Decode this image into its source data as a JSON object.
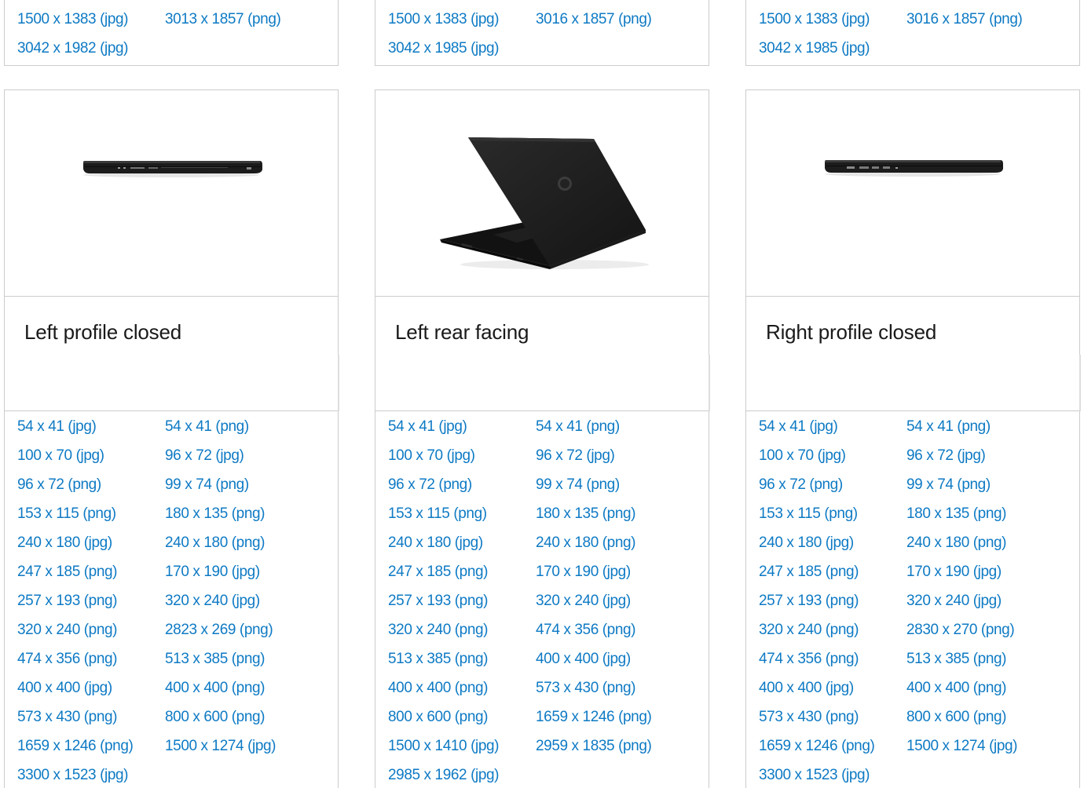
{
  "top_cards": [
    {
      "links": [
        "1500 x 1383 (jpg)",
        "3013 x 1857 (png)",
        "3042 x 1982 (jpg)"
      ]
    },
    {
      "links": [
        "1500 x 1383 (jpg)",
        "3016 x 1857 (png)",
        "3042 x 1985 (jpg)"
      ]
    },
    {
      "links": [
        "1500 x 1383 (jpg)",
        "3016 x 1857 (png)",
        "3042 x 1985 (jpg)"
      ]
    }
  ],
  "cards": [
    {
      "title": "Left profile closed",
      "image_icon": "laptop-left-profile-closed",
      "links": [
        "54 x 41 (jpg)",
        "54 x 41 (png)",
        "100 x 70 (jpg)",
        "96 x 72 (jpg)",
        "96 x 72 (png)",
        "99 x 74 (png)",
        "153 x 115 (png)",
        "180 x 135 (png)",
        "240 x 180 (jpg)",
        "240 x 180 (png)",
        "247 x 185 (png)",
        "170 x 190 (jpg)",
        "257 x 193 (png)",
        "320 x 240 (jpg)",
        "320 x 240 (png)",
        "2823 x 269 (png)",
        "474 x 356 (png)",
        "513 x 385 (png)",
        "400 x 400 (jpg)",
        "400 x 400 (png)",
        "573 x 430 (png)",
        "800 x 600 (png)",
        "1659 x 1246 (png)",
        "1500 x 1274 (jpg)",
        "3300 x 1523 (jpg)"
      ]
    },
    {
      "title": "Left rear facing",
      "image_icon": "laptop-left-rear-facing",
      "links": [
        "54 x 41 (jpg)",
        "54 x 41 (png)",
        "100 x 70 (jpg)",
        "96 x 72 (jpg)",
        "96 x 72 (png)",
        "99 x 74 (png)",
        "153 x 115 (png)",
        "180 x 135 (png)",
        "240 x 180 (jpg)",
        "240 x 180 (png)",
        "247 x 185 (png)",
        "170 x 190 (jpg)",
        "257 x 193 (png)",
        "320 x 240 (jpg)",
        "320 x 240 (png)",
        "474 x 356 (png)",
        "513 x 385 (png)",
        "400 x 400 (jpg)",
        "400 x 400 (png)",
        "573 x 430 (png)",
        "800 x 600 (png)",
        "1659 x 1246 (png)",
        "1500 x 1410 (jpg)",
        "2959 x 1835 (png)",
        "2985 x 1962 (jpg)"
      ]
    },
    {
      "title": "Right profile closed",
      "image_icon": "laptop-right-profile-closed",
      "links": [
        "54 x 41 (jpg)",
        "54 x 41 (png)",
        "100 x 70 (jpg)",
        "96 x 72 (jpg)",
        "96 x 72 (png)",
        "99 x 74 (png)",
        "153 x 115 (png)",
        "180 x 135 (png)",
        "240 x 180 (jpg)",
        "240 x 180 (png)",
        "247 x 185 (png)",
        "170 x 190 (jpg)",
        "257 x 193 (png)",
        "320 x 240 (jpg)",
        "320 x 240 (png)",
        "2830 x 270 (png)",
        "474 x 356 (png)",
        "513 x 385 (png)",
        "400 x 400 (jpg)",
        "400 x 400 (png)",
        "573 x 430 (png)",
        "800 x 600 (png)",
        "1659 x 1246 (png)",
        "1500 x 1274 (jpg)",
        "3300 x 1523 (jpg)"
      ]
    }
  ],
  "colors": {
    "link": "#0e7ac4",
    "border": "#cccccc",
    "title": "#1a1a1a",
    "laptop": "#1c1c1c"
  }
}
